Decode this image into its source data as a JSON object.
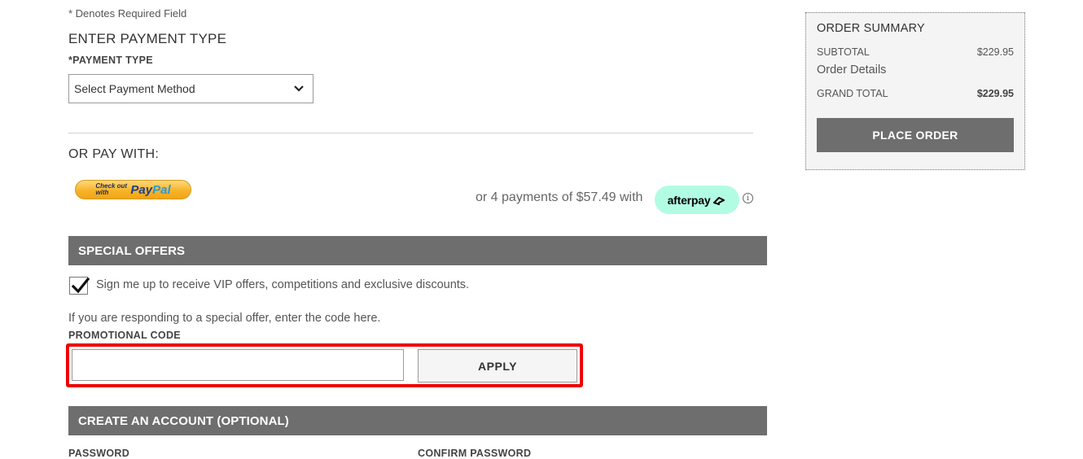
{
  "payment": {
    "required_note": "* Denotes Required Field",
    "heading": "ENTER PAYMENT TYPE",
    "type_label": "*PAYMENT TYPE",
    "select_value": "Select Payment Method"
  },
  "alt_payment": {
    "heading": "OR PAY WITH:",
    "paypal_checkout": "Check out with",
    "paypal_brand_a": "Pay",
    "paypal_brand_b": "Pal",
    "afterpay_text": "or 4 payments of $57.49 with",
    "afterpay_brand": "afterpay",
    "info_symbol": "i"
  },
  "special_offers": {
    "header": "SPECIAL OFFERS",
    "signup_checked": true,
    "signup_label": "Sign me up to receive VIP offers, competitions and exclusive discounts.",
    "offer_note": "If you are responding to a special offer, enter the code here.",
    "promo_label": "PROMOTIONAL CODE",
    "promo_value": "",
    "apply_label": "APPLY"
  },
  "account": {
    "header": "CREATE AN ACCOUNT (OPTIONAL)",
    "password_label": "PASSWORD",
    "confirm_label": "CONFIRM PASSWORD"
  },
  "summary": {
    "title": "ORDER SUMMARY",
    "subtotal_label": "SUBTOTAL",
    "subtotal_value": "$229.95",
    "details_label": "Order Details",
    "grand_label": "GRAND TOTAL",
    "grand_value": "$229.95",
    "place_order_label": "PLACE ORDER"
  },
  "colors": {
    "bar_bg": "#6e6e6e",
    "highlight": "#ee0000",
    "afterpay_mint": "#b2fce4"
  }
}
